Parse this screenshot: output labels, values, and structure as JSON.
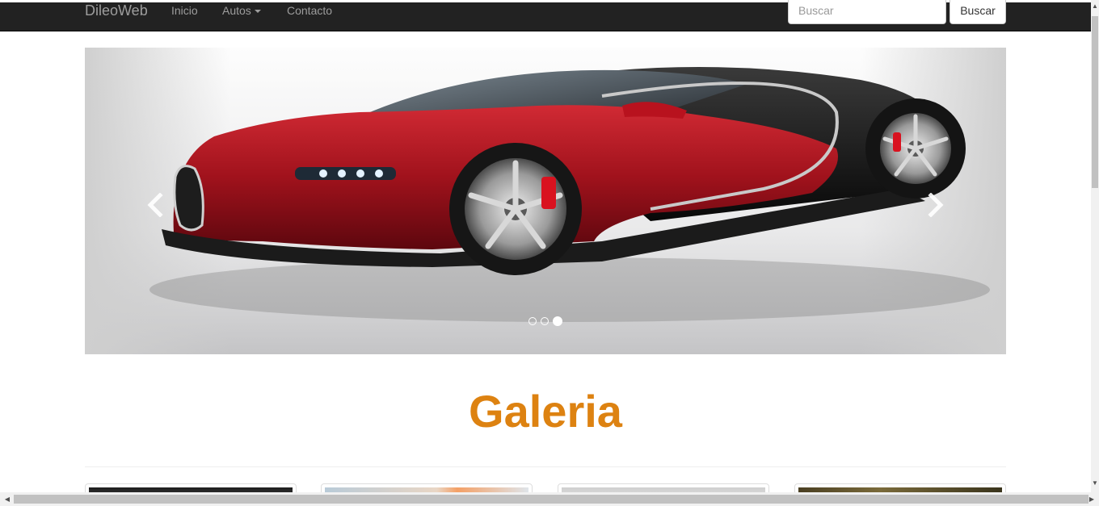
{
  "navbar": {
    "brand": "DileoWeb",
    "links": [
      {
        "label": "Inicio"
      },
      {
        "label": "Autos",
        "dropdown": true
      },
      {
        "label": "Contacto"
      }
    ],
    "search": {
      "placeholder": "Buscar",
      "value": "",
      "button_label": "Buscar"
    },
    "background_color": "#222222",
    "link_color": "#9d9d9d"
  },
  "carousel": {
    "slide_count": 3,
    "active_slide": 3,
    "prev_icon": "chevron-left-icon",
    "next_icon": "chevron-right-icon",
    "image_subject": "red and black sports car"
  },
  "gallery": {
    "title": "Galeria",
    "title_color": "#dd8211",
    "thumbnail_count": 4
  },
  "scrollbars": {
    "vertical": true,
    "horizontal": true
  }
}
